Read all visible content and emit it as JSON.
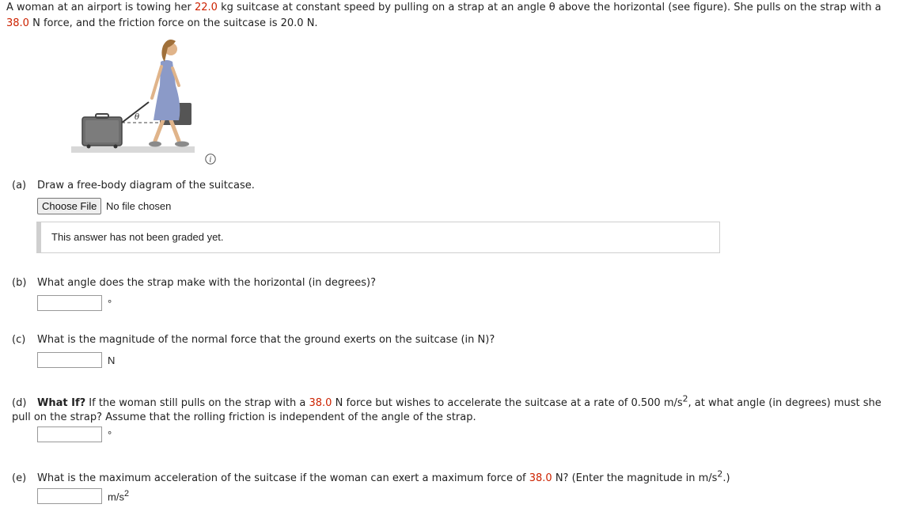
{
  "intro": {
    "p1": "A woman at an airport is towing her ",
    "mass": "22.0",
    "p2": " kg suitcase at constant speed by pulling on a strap at an angle θ above the horizontal (see figure). She pulls on the strap with a ",
    "force": "38.0",
    "p3": " N force, and the friction force on the suitcase is 20.0 N."
  },
  "figure": {
    "angle_label": "θ"
  },
  "questions": {
    "a": {
      "label": "(a)",
      "text": "Draw a free-body diagram of the suitcase.",
      "file_button": "Choose File",
      "file_status": "No file chosen",
      "graded_note": "This answer has not been graded yet."
    },
    "b": {
      "label": "(b)",
      "text": "What angle does the strap make with the horizontal (in degrees)?",
      "unit": "°"
    },
    "c": {
      "label": "(c)",
      "text": "What is the magnitude of the normal force that the ground exerts on the suitcase (in N)?",
      "unit": "N"
    },
    "d": {
      "label": "(d)",
      "bold": "What If?",
      "p1": " If the woman still pulls on the strap with a ",
      "force": "38.0",
      "p2": " N force but wishes to accelerate the suitcase at a rate of 0.500 m/s",
      "sup": "2",
      "p3": ", at what angle (in degrees) must she pull on the strap? Assume that the rolling friction is independent of the angle of the strap.",
      "unit": "°"
    },
    "e": {
      "label": "(e)",
      "p1": "What is the maximum acceleration of the suitcase if the woman can exert a maximum force of ",
      "force": "38.0",
      "p2": " N? (Enter the magnitude in m/s",
      "sup": "2",
      "p3": ".)",
      "unit": "m/s",
      "unit_sup": "2"
    }
  },
  "colors": {
    "highlight": "#cc2200"
  }
}
